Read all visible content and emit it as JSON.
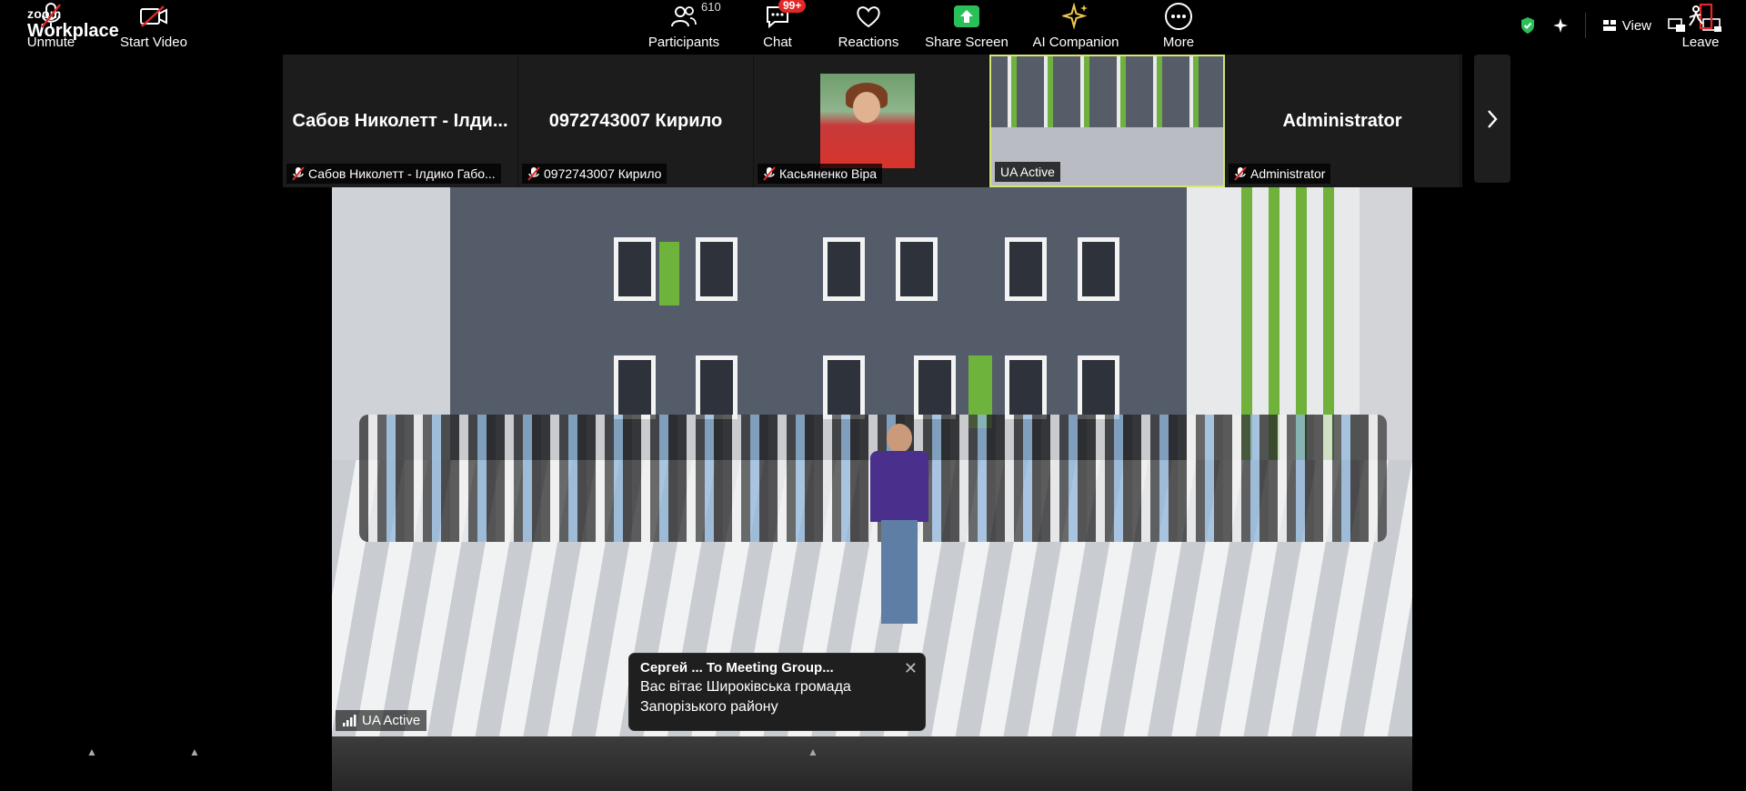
{
  "app": {
    "logo_small": "zoom",
    "logo_big": "Workplace"
  },
  "topbar": {
    "view_label": "View"
  },
  "thumbnails": [
    {
      "display_name": "Сабов Николетт - Ілди...",
      "label": "Сабов Николетт - Ілдико Габо...",
      "muted": true,
      "type": "name"
    },
    {
      "display_name": "0972743007 Кирило",
      "label": "0972743007 Кирило",
      "muted": true,
      "type": "name"
    },
    {
      "display_name": "",
      "label": "Касьяненко Віра",
      "muted": true,
      "type": "photo"
    },
    {
      "display_name": "",
      "label": "UA Active",
      "muted": false,
      "type": "video",
      "active": true
    },
    {
      "display_name": "Administrator",
      "label": "Administrator",
      "muted": true,
      "type": "name"
    }
  ],
  "main_video": {
    "label": "UA Active"
  },
  "chat_popup": {
    "sender": "Сергей ... To Meeting Group...",
    "message_line1": "Вас вітає Широківська громада",
    "message_line2": "Запорізького району"
  },
  "toolbar": {
    "unmute": "Unmute",
    "start_video": "Start Video",
    "participants": "Participants",
    "participants_count": "610",
    "chat": "Chat",
    "chat_badge": "99+",
    "reactions": "Reactions",
    "share_screen": "Share Screen",
    "ai_companion": "AI Companion",
    "more": "More",
    "leave": "Leave"
  },
  "colors": {
    "active_border": "#d6e472",
    "share_green": "#2bbf5a",
    "leave_red": "#e02828",
    "badge_red": "#e02828",
    "ai_yellow": "#f2c94c"
  }
}
